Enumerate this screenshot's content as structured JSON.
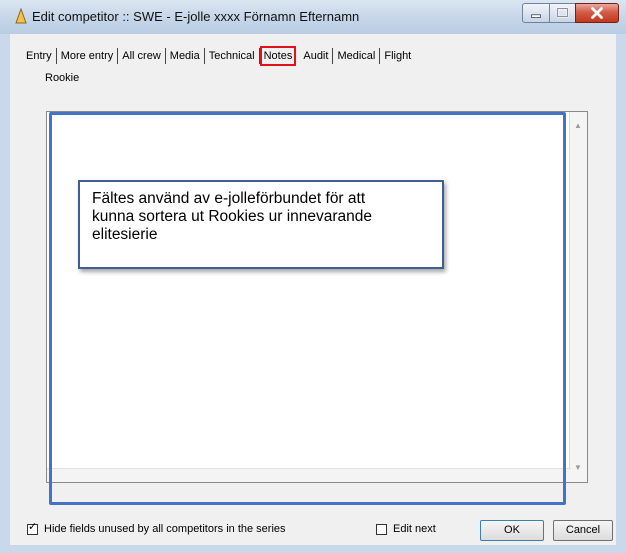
{
  "window": {
    "title": "Edit competitor :: SWE - E-jolle xxxx Förnamn Efternamn",
    "controls": {
      "minimize_icon": "minimize-icon",
      "maximize_icon": "maximize-icon",
      "close_icon": "close-icon"
    }
  },
  "tabs": [
    {
      "label": "Entry",
      "active": false
    },
    {
      "label": "More entry",
      "active": false
    },
    {
      "label": "All crew",
      "active": false
    },
    {
      "label": "Media",
      "active": false
    },
    {
      "label": "Technical",
      "active": false
    },
    {
      "label": "Notes",
      "active": true
    },
    {
      "label": "Audit",
      "active": false
    },
    {
      "label": "Medical",
      "active": false
    },
    {
      "label": "Flight",
      "active": false
    }
  ],
  "notes": {
    "field_label": "Rookie",
    "memo_value": "",
    "callout_text": "Fältes använd av e-jolleförbundet för att\nkunna sortera ut Rookies ur innevarande\nelitesierie"
  },
  "footer": {
    "hide_fields_label": "Hide fields unused by all competitors in the series",
    "hide_fields_checked": true,
    "edit_next_label": "Edit next",
    "edit_next_checked": false,
    "ok_label": "OK",
    "cancel_label": "Cancel"
  },
  "colors": {
    "highlight_active_tab": "#e0121e",
    "annotation_border": "#4472c4",
    "callout_border": "#3e5f95"
  }
}
